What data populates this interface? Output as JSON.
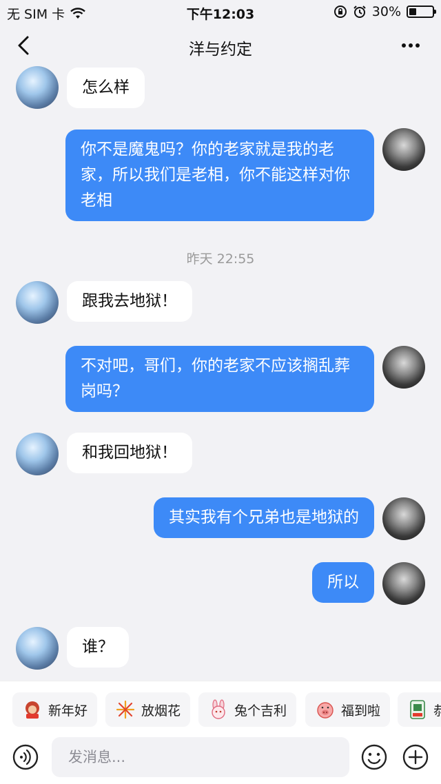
{
  "status_bar": {
    "carrier": "无 SIM 卡",
    "time": "下午12:03",
    "battery_text": "30%",
    "battery_level": 0.3
  },
  "header": {
    "title": "洋与约定"
  },
  "messages": [
    {
      "from": "other",
      "text": "怎么样"
    },
    {
      "from": "me",
      "text": "你不是魔鬼吗？你的老家就是我的老家，所以我们是老相，你不能这样对你老相"
    },
    {
      "type": "timestamp",
      "text": "昨天 22:55"
    },
    {
      "from": "other",
      "text": "跟我去地狱！"
    },
    {
      "from": "me",
      "text": "不对吧，哥们，你的老家不应该搁乱葬岗吗？"
    },
    {
      "from": "other",
      "text": "和我回地狱！"
    },
    {
      "from": "me",
      "text": "其实我有个兄弟也是地狱的"
    },
    {
      "from": "me",
      "text": "所以"
    },
    {
      "from": "other",
      "text": "谁？"
    }
  ],
  "quick_replies": [
    {
      "label": "新年好",
      "icon": "monkey-icon"
    },
    {
      "label": "放烟花",
      "icon": "fireworks-icon"
    },
    {
      "label": "兔个吉利",
      "icon": "rabbit-icon"
    },
    {
      "label": "福到啦",
      "icon": "pig-icon"
    },
    {
      "label": "恭",
      "icon": "mahjong-icon"
    }
  ],
  "input": {
    "placeholder": "发消息..."
  },
  "colors": {
    "outgoing_bubble": "#3d8af7",
    "incoming_bubble": "#ffffff",
    "background": "#f2f2f5"
  }
}
